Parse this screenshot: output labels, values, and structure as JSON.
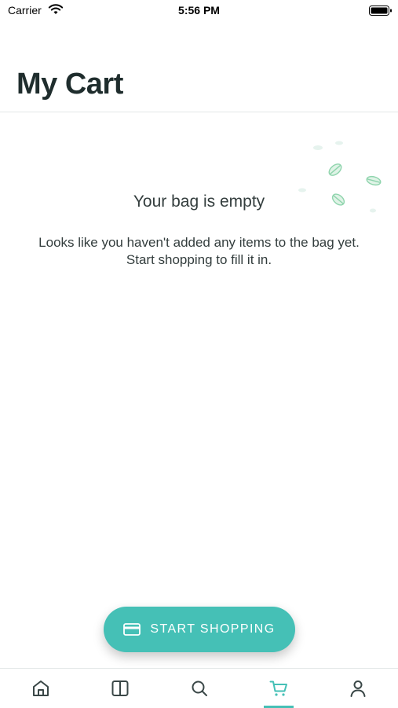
{
  "status_bar": {
    "carrier": "Carrier",
    "time": "5:56 PM",
    "icons": [
      "wifi-icon",
      "battery-icon"
    ]
  },
  "header": {
    "title": "My Cart"
  },
  "empty_state": {
    "title": "Your bag is empty",
    "message": "Looks like you haven't added any items to the bag yet. Start shopping to fill it in.",
    "decoration_icon": "leaves-icon"
  },
  "cta": {
    "label": "START SHOPPING",
    "icon": "credit-card-icon"
  },
  "tab_bar": {
    "tabs": [
      {
        "icon": "home-icon",
        "active": false
      },
      {
        "icon": "catalog-icon",
        "active": false
      },
      {
        "icon": "search-icon",
        "active": false
      },
      {
        "icon": "cart-icon",
        "active": true
      },
      {
        "icon": "profile-icon",
        "active": false
      }
    ]
  },
  "colors": {
    "accent": "#45c0b6",
    "text": "#1f2d2d",
    "leaf": "#8fd4ad"
  }
}
